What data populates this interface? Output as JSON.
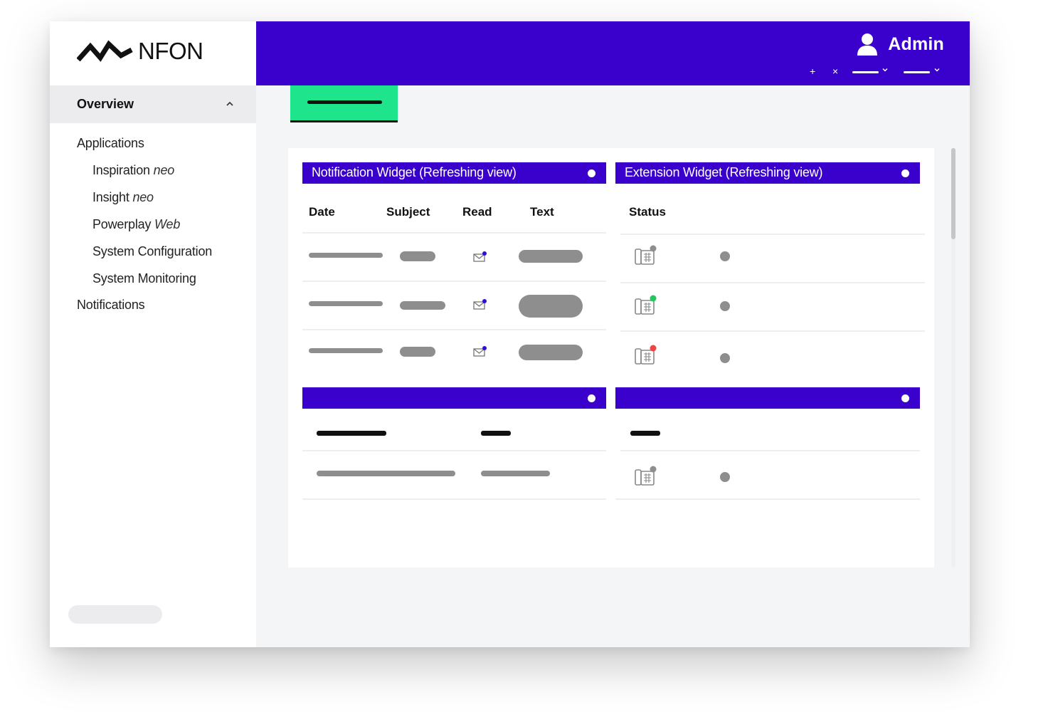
{
  "brand": {
    "name": "NFON"
  },
  "sidebar": {
    "overview_label": "Overview",
    "items": [
      {
        "label": "Applications",
        "suffix": ""
      },
      {
        "label": "Inspiration ",
        "suffix": "neo"
      },
      {
        "label": "Insight ",
        "suffix": "neo"
      },
      {
        "label": "Powerplay ",
        "suffix": "Web"
      },
      {
        "label": "System Configuration",
        "suffix": ""
      },
      {
        "label": "System Monitoring",
        "suffix": ""
      },
      {
        "label": "Notifications",
        "suffix": ""
      }
    ]
  },
  "header": {
    "user_label": "Admin",
    "add_symbol": "+",
    "close_symbol": "×"
  },
  "notification_widget": {
    "title": "Notification Widget  (Refreshing view)",
    "columns": [
      "Date",
      "Subject",
      "Read",
      "Text"
    ],
    "rows": [
      {
        "read_icon": "mail-read-icon"
      },
      {
        "read_icon": "mail-read-icon"
      },
      {
        "read_icon": "mail-read-icon"
      }
    ]
  },
  "extension_widget": {
    "title": "Extension Widget  (Refreshing view)",
    "columns": [
      "Status"
    ],
    "rows": [
      {
        "status_color": "#8e8e8e"
      },
      {
        "status_color": "#22c55e"
      },
      {
        "status_color": "#ef4444"
      }
    ]
  },
  "colors": {
    "brand_purple": "#3a00cc",
    "accent_green": "#1ee58b",
    "placeholder_gray": "#8e8e8e",
    "status_online": "#22c55e",
    "status_busy": "#ef4444"
  },
  "icons": [
    "user-icon",
    "chevron-up-icon",
    "chevron-down-icon",
    "mail-read-icon",
    "desk-phone-icon"
  ]
}
